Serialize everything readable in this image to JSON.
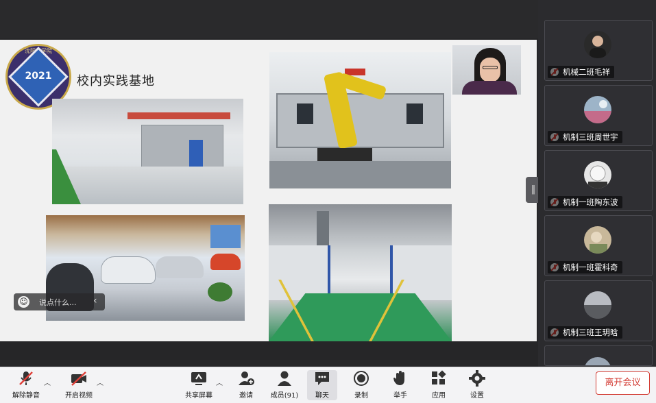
{
  "slide": {
    "title": "校内实践基地",
    "logo_year": "2021",
    "logo_ring_text": "沈阳工学院"
  },
  "chat": {
    "placeholder": "说点什么..."
  },
  "participants": [
    {
      "name": "机械二班毛祥",
      "avatar_color": "#2a2a2a"
    },
    {
      "name": "机制三班周世宇",
      "avatar_color": "#9db4c8"
    },
    {
      "name": "机制一班陶东波",
      "avatar_color": "#e6e6e6"
    },
    {
      "name": "机制一班霍科奇",
      "avatar_color": "#c8b89a"
    },
    {
      "name": "机制三班王玥晗",
      "avatar_color": "#8a8c92"
    }
  ],
  "toolbar": {
    "unmute": "解除静音",
    "start_video": "开启视频",
    "share_screen": "共享屏幕",
    "invite": "邀请",
    "members": "成员(91)",
    "chat": "聊天",
    "record": "录制",
    "raise_hand": "举手",
    "apps": "应用",
    "settings": "设置",
    "leave": "离开会议"
  },
  "colors": {
    "leave": "#d33b33",
    "mute_off": "#e0413a"
  }
}
